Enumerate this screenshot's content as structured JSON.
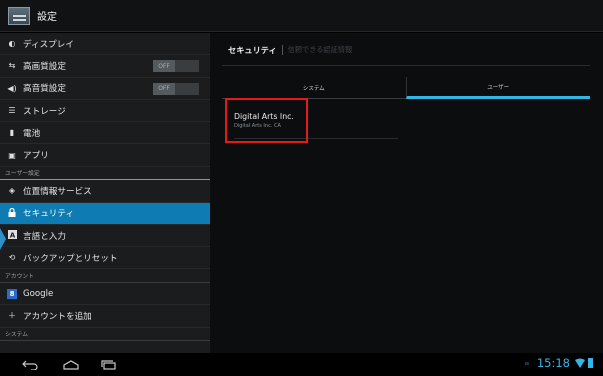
{
  "app": {
    "title": "設定",
    "icon": "settings-app-icon"
  },
  "sidebar": {
    "items": [
      {
        "icon": "display-icon",
        "glyph": "◐",
        "label": "ディスプレイ"
      },
      {
        "icon": "video-quality-icon",
        "glyph": "⇆",
        "label": "高画質設定",
        "toggle": "OFF"
      },
      {
        "icon": "sound-quality-icon",
        "glyph": "◀)",
        "label": "高音質設定",
        "toggle": "OFF"
      },
      {
        "icon": "storage-icon",
        "glyph": "☰",
        "label": "ストレージ"
      },
      {
        "icon": "battery-icon",
        "glyph": "▮",
        "label": "電池"
      },
      {
        "icon": "apps-icon",
        "glyph": "▣",
        "label": "アプリ"
      }
    ],
    "headers": {
      "user": "ユーザー設定",
      "account": "アカウント",
      "system": "システム"
    },
    "user_items": [
      {
        "icon": "location-icon",
        "glyph": "◈",
        "label": "位置情報サービス"
      },
      {
        "icon": "lock-icon",
        "glyph": "🔒︎",
        "label": "セキュリティ",
        "selected": true
      },
      {
        "icon": "language-icon",
        "glyph": "A",
        "label": "言語と入力"
      },
      {
        "icon": "backup-icon",
        "glyph": "⟲",
        "label": "バックアップとリセット"
      }
    ],
    "account_items": [
      {
        "icon": "google-icon",
        "glyph": "8",
        "label": "Google"
      },
      {
        "icon": "add-icon",
        "glyph": "＋",
        "label": "アカウントを追加"
      }
    ]
  },
  "main": {
    "breadcrumb": {
      "title": "セキュリティ",
      "subtitle": "信頼できる認証情報"
    },
    "tabs": [
      {
        "label": "システム",
        "active": false
      },
      {
        "label": "ユーザー",
        "active": true
      }
    ],
    "certificate": {
      "name": "Digital Arts Inc.",
      "org": "Digital Arts Inc. CA"
    }
  },
  "statusbar": {
    "time": "15:18"
  },
  "colors": {
    "accent": "#33b5e5",
    "selected": "#0e7bb2",
    "highlight": "#e31b1b"
  }
}
